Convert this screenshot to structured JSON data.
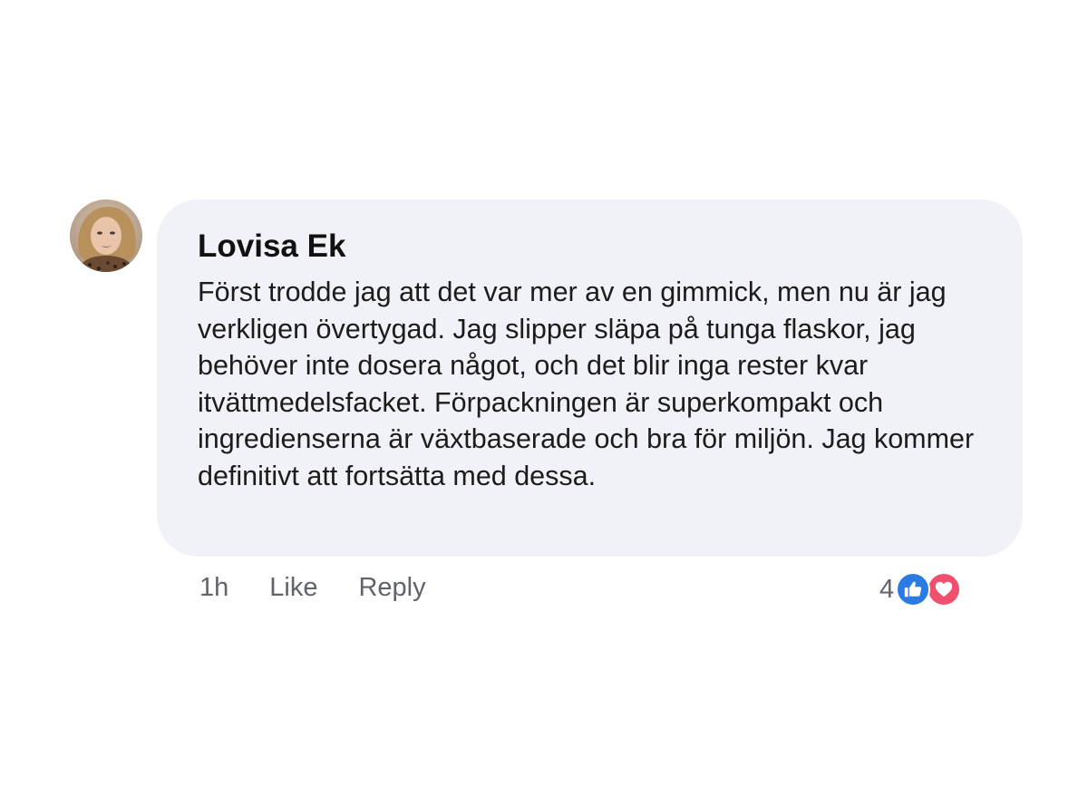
{
  "comment": {
    "author": "Lovisa Ek",
    "text": "Först trodde jag att det var mer av en gimmick, men nu är jag verkligen övertygad. Jag slipper släpa på tunga flaskor, jag behöver inte dosera något, och det blir inga rester kvar itvättmedelsfacket. Förpackningen är superkompakt och ingredienserna är växtbaserade och bra för miljön. Jag kommer definitivt att fortsätta med dessa.",
    "avatar_icon": "avatar-photo"
  },
  "actions": {
    "time": "1h",
    "like_label": "Like",
    "reply_label": "Reply"
  },
  "reactions": {
    "count": "4",
    "icons": [
      "thumbs-up-icon",
      "heart-icon"
    ],
    "colors": {
      "like": "#2a7be4",
      "love": "#f0506e"
    }
  },
  "colors": {
    "bubble_background": "#f1f2f7",
    "meta_text": "#60636b"
  }
}
